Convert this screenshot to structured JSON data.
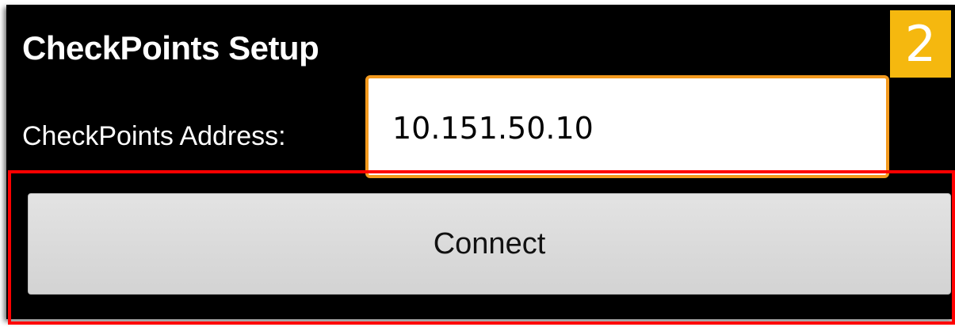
{
  "screen": {
    "title": "CheckPoints Setup",
    "step_badge": "2",
    "address_label": "CheckPoints Address:",
    "address_value": "10.151.50.10",
    "connect_label": "Connect"
  },
  "colors": {
    "background": "#000000",
    "badge": "#f5b80f",
    "field_focus_border": "#f39a1e",
    "highlight": "#ff0000",
    "button": "#d9d9d9"
  }
}
